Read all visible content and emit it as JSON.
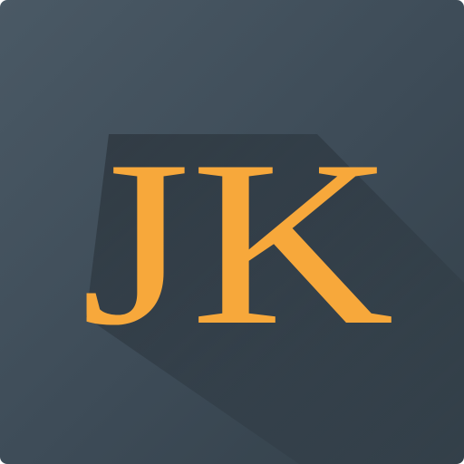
{
  "icon": {
    "monogram": "JK",
    "colors": {
      "background": "#3d4b57",
      "background_highlight": "#4a5965",
      "background_shade": "#334049",
      "long_shadow": "#2b363f",
      "letter": "#f7a83b"
    }
  }
}
